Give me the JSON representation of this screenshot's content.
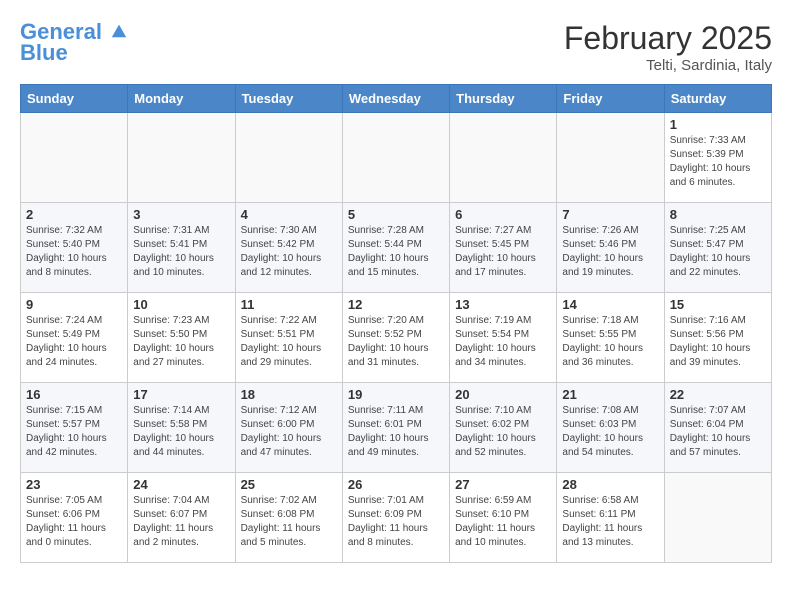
{
  "header": {
    "logo_line1": "General",
    "logo_line2": "Blue",
    "month_title": "February 2025",
    "location": "Telti, Sardinia, Italy"
  },
  "weekdays": [
    "Sunday",
    "Monday",
    "Tuesday",
    "Wednesday",
    "Thursday",
    "Friday",
    "Saturday"
  ],
  "weeks": [
    [
      {
        "day": "",
        "info": ""
      },
      {
        "day": "",
        "info": ""
      },
      {
        "day": "",
        "info": ""
      },
      {
        "day": "",
        "info": ""
      },
      {
        "day": "",
        "info": ""
      },
      {
        "day": "",
        "info": ""
      },
      {
        "day": "1",
        "info": "Sunrise: 7:33 AM\nSunset: 5:39 PM\nDaylight: 10 hours and 6 minutes."
      }
    ],
    [
      {
        "day": "2",
        "info": "Sunrise: 7:32 AM\nSunset: 5:40 PM\nDaylight: 10 hours and 8 minutes."
      },
      {
        "day": "3",
        "info": "Sunrise: 7:31 AM\nSunset: 5:41 PM\nDaylight: 10 hours and 10 minutes."
      },
      {
        "day": "4",
        "info": "Sunrise: 7:30 AM\nSunset: 5:42 PM\nDaylight: 10 hours and 12 minutes."
      },
      {
        "day": "5",
        "info": "Sunrise: 7:28 AM\nSunset: 5:44 PM\nDaylight: 10 hours and 15 minutes."
      },
      {
        "day": "6",
        "info": "Sunrise: 7:27 AM\nSunset: 5:45 PM\nDaylight: 10 hours and 17 minutes."
      },
      {
        "day": "7",
        "info": "Sunrise: 7:26 AM\nSunset: 5:46 PM\nDaylight: 10 hours and 19 minutes."
      },
      {
        "day": "8",
        "info": "Sunrise: 7:25 AM\nSunset: 5:47 PM\nDaylight: 10 hours and 22 minutes."
      }
    ],
    [
      {
        "day": "9",
        "info": "Sunrise: 7:24 AM\nSunset: 5:49 PM\nDaylight: 10 hours and 24 minutes."
      },
      {
        "day": "10",
        "info": "Sunrise: 7:23 AM\nSunset: 5:50 PM\nDaylight: 10 hours and 27 minutes."
      },
      {
        "day": "11",
        "info": "Sunrise: 7:22 AM\nSunset: 5:51 PM\nDaylight: 10 hours and 29 minutes."
      },
      {
        "day": "12",
        "info": "Sunrise: 7:20 AM\nSunset: 5:52 PM\nDaylight: 10 hours and 31 minutes."
      },
      {
        "day": "13",
        "info": "Sunrise: 7:19 AM\nSunset: 5:54 PM\nDaylight: 10 hours and 34 minutes."
      },
      {
        "day": "14",
        "info": "Sunrise: 7:18 AM\nSunset: 5:55 PM\nDaylight: 10 hours and 36 minutes."
      },
      {
        "day": "15",
        "info": "Sunrise: 7:16 AM\nSunset: 5:56 PM\nDaylight: 10 hours and 39 minutes."
      }
    ],
    [
      {
        "day": "16",
        "info": "Sunrise: 7:15 AM\nSunset: 5:57 PM\nDaylight: 10 hours and 42 minutes."
      },
      {
        "day": "17",
        "info": "Sunrise: 7:14 AM\nSunset: 5:58 PM\nDaylight: 10 hours and 44 minutes."
      },
      {
        "day": "18",
        "info": "Sunrise: 7:12 AM\nSunset: 6:00 PM\nDaylight: 10 hours and 47 minutes."
      },
      {
        "day": "19",
        "info": "Sunrise: 7:11 AM\nSunset: 6:01 PM\nDaylight: 10 hours and 49 minutes."
      },
      {
        "day": "20",
        "info": "Sunrise: 7:10 AM\nSunset: 6:02 PM\nDaylight: 10 hours and 52 minutes."
      },
      {
        "day": "21",
        "info": "Sunrise: 7:08 AM\nSunset: 6:03 PM\nDaylight: 10 hours and 54 minutes."
      },
      {
        "day": "22",
        "info": "Sunrise: 7:07 AM\nSunset: 6:04 PM\nDaylight: 10 hours and 57 minutes."
      }
    ],
    [
      {
        "day": "23",
        "info": "Sunrise: 7:05 AM\nSunset: 6:06 PM\nDaylight: 11 hours and 0 minutes."
      },
      {
        "day": "24",
        "info": "Sunrise: 7:04 AM\nSunset: 6:07 PM\nDaylight: 11 hours and 2 minutes."
      },
      {
        "day": "25",
        "info": "Sunrise: 7:02 AM\nSunset: 6:08 PM\nDaylight: 11 hours and 5 minutes."
      },
      {
        "day": "26",
        "info": "Sunrise: 7:01 AM\nSunset: 6:09 PM\nDaylight: 11 hours and 8 minutes."
      },
      {
        "day": "27",
        "info": "Sunrise: 6:59 AM\nSunset: 6:10 PM\nDaylight: 11 hours and 10 minutes."
      },
      {
        "day": "28",
        "info": "Sunrise: 6:58 AM\nSunset: 6:11 PM\nDaylight: 11 hours and 13 minutes."
      },
      {
        "day": "",
        "info": ""
      }
    ]
  ]
}
